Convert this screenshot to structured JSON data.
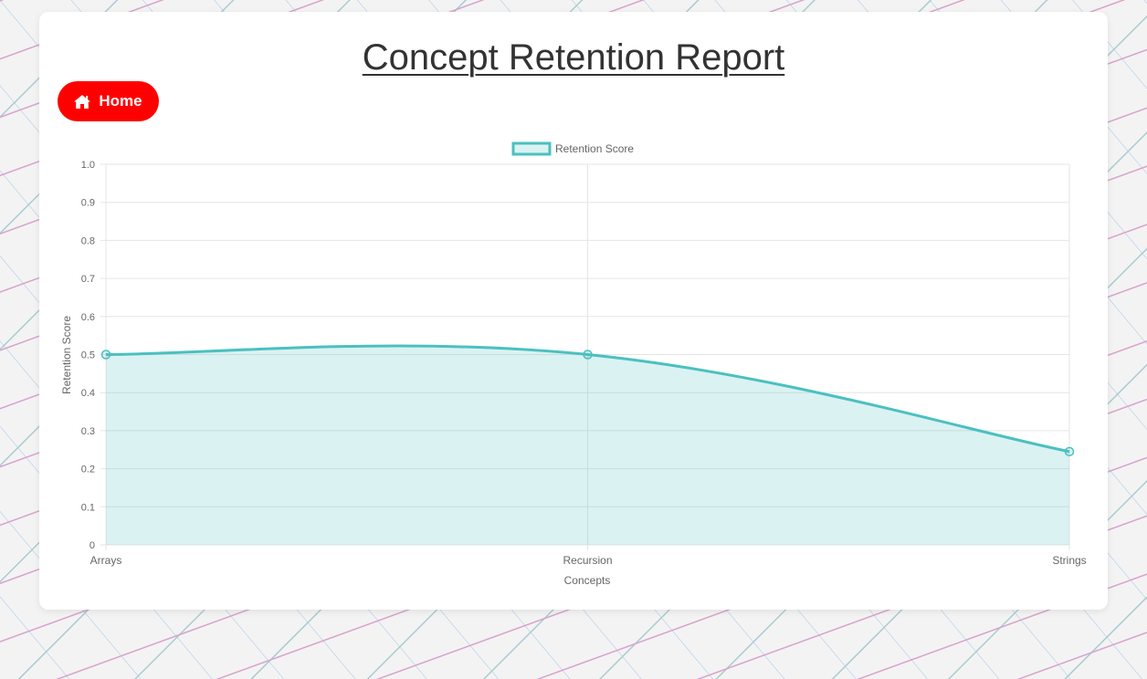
{
  "page": {
    "title": "Concept Retention Report",
    "home_button": {
      "label": "Home",
      "icon": "home-icon"
    },
    "colors": {
      "button": "#ff0000",
      "line": "#4bc0c0",
      "fill": "rgba(75,192,192,0.2)"
    }
  },
  "chart_data": {
    "type": "area",
    "categories": [
      "Arrays",
      "Recursion",
      "Strings"
    ],
    "series": [
      {
        "name": "Retention Score",
        "values": [
          0.5,
          0.5,
          0.245
        ]
      }
    ],
    "xlabel": "Concepts",
    "ylabel": "Retention Score",
    "ylim": [
      0,
      1
    ],
    "yticks": [
      "0",
      "0.1",
      "0.2",
      "0.3",
      "0.4",
      "0.5",
      "0.6",
      "0.7",
      "0.8",
      "0.9",
      "1.0"
    ],
    "grid": true,
    "legend": "top-center"
  }
}
